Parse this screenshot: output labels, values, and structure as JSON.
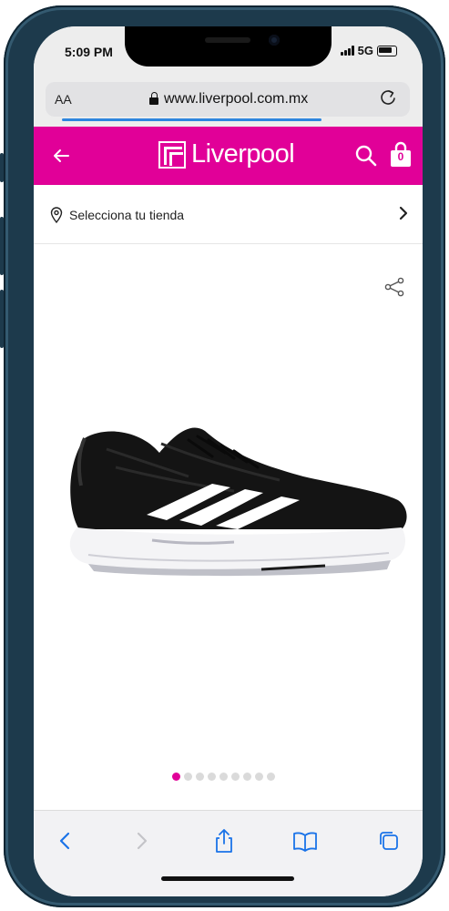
{
  "status_bar": {
    "time": "5:09 PM",
    "network": "5G",
    "signal_icon": "signal-bars-icon",
    "battery_icon": "battery-icon"
  },
  "browser": {
    "text_size_label": "AA",
    "url": "www.liverpool.com.mx",
    "lock_icon": "lock-icon",
    "reload_icon": "reload-icon"
  },
  "header": {
    "brand": "Liverpool",
    "cart_count": "0",
    "background_color": "#e10098",
    "back_icon": "back-arrow-icon",
    "search_icon": "search-icon",
    "cart_icon": "shopping-bag-icon"
  },
  "store_selector": {
    "label": "Selecciona tu tienda",
    "pin_icon": "location-pin-icon",
    "chevron_icon": "chevron-right-icon"
  },
  "product": {
    "share_icon": "share-icon",
    "image_icon": "running-shoe-image",
    "carousel_total": 9,
    "carousel_active": 1,
    "active_dot_color": "#e10098"
  },
  "toolbar": {
    "items": [
      "back-icon",
      "forward-icon",
      "share-icon",
      "bookmarks-icon",
      "tabs-icon"
    ]
  }
}
